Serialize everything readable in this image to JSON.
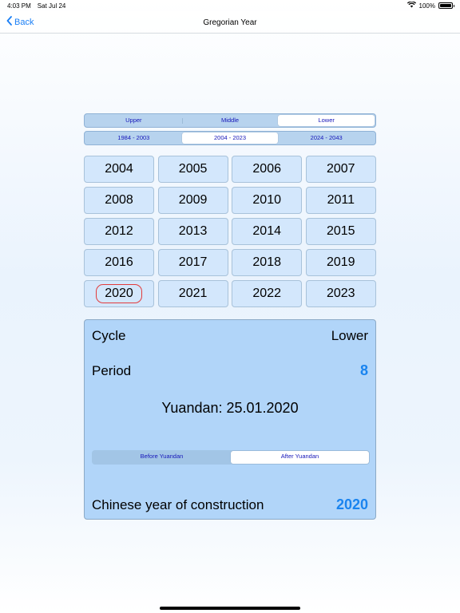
{
  "status_bar": {
    "time": "4:03 PM",
    "date": "Sat Jul 24",
    "battery": "100%",
    "battery_level": 1.0
  },
  "nav": {
    "back_label": "Back",
    "title": "Gregorian Year"
  },
  "cycle_segment": {
    "items": [
      {
        "label": "Upper",
        "active": false
      },
      {
        "label": "Middle",
        "active": false
      },
      {
        "label": "Lower",
        "active": true
      }
    ]
  },
  "range_segment": {
    "items": [
      {
        "label": "1984 - 2003",
        "active": false
      },
      {
        "label": "2004 - 2023",
        "active": true
      },
      {
        "label": "2024 - 2043",
        "active": false
      }
    ]
  },
  "years": [
    "2004",
    "2005",
    "2006",
    "2007",
    "2008",
    "2009",
    "2010",
    "2011",
    "2012",
    "2013",
    "2014",
    "2015",
    "2016",
    "2017",
    "2018",
    "2019",
    "2020",
    "2021",
    "2022",
    "2023"
  ],
  "selected_year": "2020",
  "details": {
    "cycle_label": "Cycle",
    "cycle_value": "Lower",
    "period_label": "Period",
    "period_value": "8",
    "yuandan": "Yuandan: 25.01.2020",
    "yuandan_segment": [
      {
        "label": "Before Yuandan",
        "active": false
      },
      {
        "label": "After Yuandan",
        "active": true
      }
    ],
    "construction_label": "Chinese year of construction",
    "construction_value": "2020"
  },
  "colors": {
    "accent": "#1a84ef",
    "segment_text": "#1616b9",
    "panel_bg": "#b1d5f9",
    "button_bg": "#d3e7fc",
    "selection_ring": "#e23b3b"
  }
}
